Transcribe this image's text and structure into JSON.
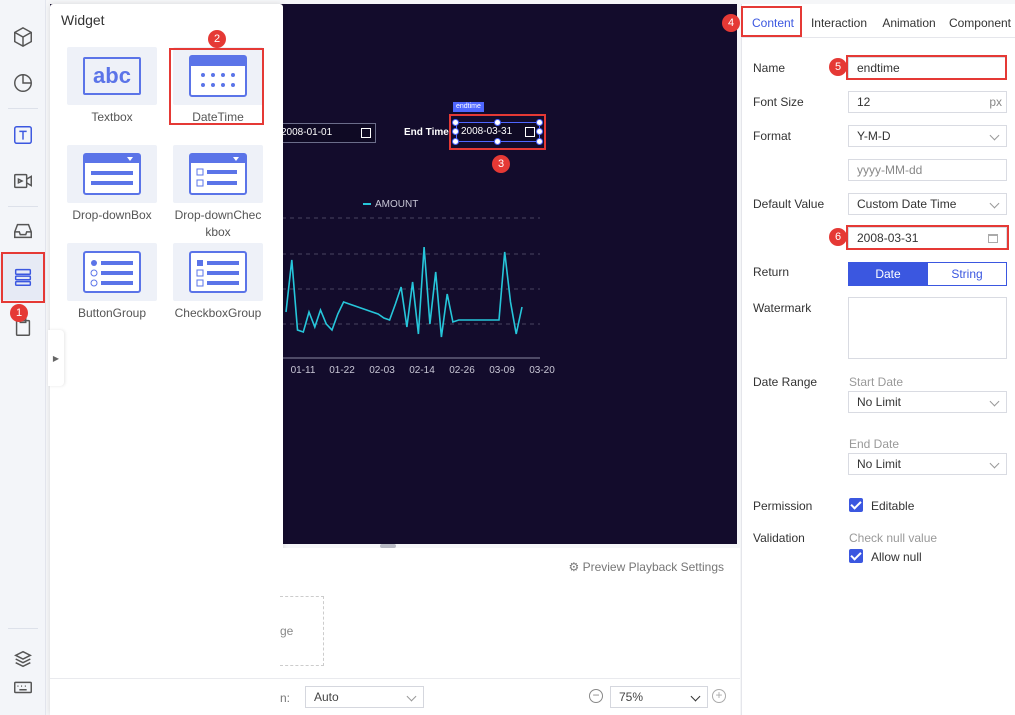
{
  "widget_panel": {
    "title": "Widget",
    "items": [
      {
        "label": "Textbox",
        "icon": "textbox-icon"
      },
      {
        "label": "DateTime",
        "icon": "calendar-icon"
      },
      {
        "label": "Drop-downBox",
        "icon": "dropdown-box-icon"
      },
      {
        "label": "Drop-downCheckbox",
        "icon": "dropdown-checkbox-icon"
      },
      {
        "label": "ButtonGroup",
        "icon": "button-group-icon"
      },
      {
        "label": "CheckboxGroup",
        "icon": "checkbox-group-icon"
      }
    ],
    "textbox_thumb": "abc"
  },
  "canvas": {
    "start_date_value": "2008-01-01",
    "end_label": "End Time",
    "end_date_value": "2008-03-31",
    "selected_tag": "endtime",
    "background": "#130c2c"
  },
  "chart_data": {
    "type": "line",
    "legend": "AMOUNT",
    "x_ticks": [
      "01-11",
      "01-22",
      "02-03",
      "02-14",
      "02-26",
      "03-09",
      "03-20"
    ],
    "series": [
      {
        "name": "AMOUNT",
        "color": "#26c6da",
        "values": [
          0.3,
          0.82,
          0.12,
          0.1,
          0.3,
          0.15,
          0.32,
          0.18,
          0.12,
          0.28,
          0.4,
          0.38,
          0.36,
          0.34,
          0.32,
          0.3,
          0.28,
          0.24,
          0.22,
          0.38,
          0.55,
          0.15,
          0.6,
          0.08,
          0.95,
          0.18,
          0.7,
          0.05,
          0.48,
          0.2,
          0.22,
          0.22,
          0.22,
          0.22,
          0.22,
          0.22,
          0.22,
          0.22,
          0.9,
          0.4,
          0.08,
          0.35
        ]
      }
    ]
  },
  "bottom": {
    "preview_settings": "Preview Playback Settings",
    "partial_text": "ge",
    "partial_label": "n:",
    "auto_value": "Auto",
    "zoom_value": "75%"
  },
  "props": {
    "tabs": [
      "Content",
      "Interaction",
      "Animation",
      "Component"
    ],
    "name_label": "Name",
    "name_value": "endtime",
    "font_size_label": "Font Size",
    "font_size_value": "12",
    "font_size_unit": "px",
    "format_label": "Format",
    "format_value": "Y-M-D",
    "format_placeholder": "yyyy-MM-dd",
    "default_label": "Default Value",
    "default_value": "Custom Date Time",
    "default_date": "2008-03-31",
    "return_label": "Return",
    "return_options": [
      "Date",
      "String"
    ],
    "watermark_label": "Watermark",
    "date_range_label": "Date Range",
    "start_date_label": "Start Date",
    "start_date_value": "No Limit",
    "end_date_label": "End Date",
    "end_date_value": "No Limit",
    "permission_label": "Permission",
    "editable_label": "Editable",
    "validation_label": "Validation",
    "check_null_label": "Check null value",
    "allow_null_label": "Allow null"
  },
  "badges": [
    "1",
    "2",
    "3",
    "4",
    "5",
    "6"
  ],
  "accent_color": "#3b57e0",
  "highlight_color": "#e53935"
}
